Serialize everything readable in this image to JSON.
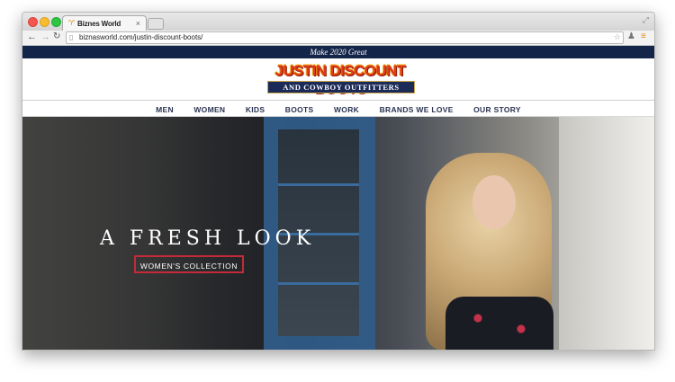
{
  "browser": {
    "tab_title": "Biznes World",
    "url": "biznasworld.com/justin-discount-boots/"
  },
  "site": {
    "announcement": "Make 2020 Great",
    "logo": {
      "line1": "JUSTIN DISCOUNT BOOTS",
      "line2": "AND COWBOY OUTFITTERS"
    },
    "nav": [
      "MEN",
      "WOMEN",
      "KIDS",
      "BOOTS",
      "WORK",
      "BRANDS WE LOVE",
      "OUR STORY"
    ],
    "hero": {
      "title": "A FRESH LOOK",
      "cta_label": "WOMEN'S COLLECTION"
    }
  },
  "colors": {
    "announcement_bg": "#14254a",
    "cta_border": "#c42a3a",
    "logo_red": "#e23a1c",
    "logo_navy": "#1b2a57"
  }
}
